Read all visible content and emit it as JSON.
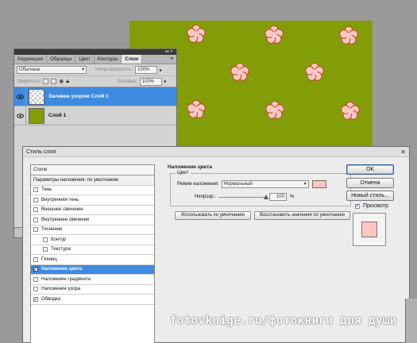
{
  "layers_panel": {
    "tabs": [
      "Коррекция",
      "Образцы",
      "Цвет",
      "Контуры",
      "Слои"
    ],
    "active_tab": "Слои",
    "blend_mode": "Обычные",
    "opacity_label": "Непрозрачность:",
    "opacity_value": "100%",
    "lock_label": "Закрепить:",
    "fill_label": "Заливка:",
    "fill_value": "100%",
    "layers": [
      {
        "name": "Заливка узором Слой 1",
        "selected": true,
        "thumb": "checker"
      },
      {
        "name": "Слой 1",
        "selected": false,
        "thumb": "green"
      }
    ]
  },
  "canvas": {
    "background": "#839d08",
    "flower_color": "#ffc8c8",
    "flower_outline": "#c05020"
  },
  "dialog": {
    "title": "Стиль слоя",
    "close": "✕",
    "styles_list": [
      {
        "label": "Стили",
        "type": "header"
      },
      {
        "label": "Параметры наложения: по умолчанию",
        "type": "param"
      },
      {
        "label": "Тень",
        "checked": false
      },
      {
        "label": "Внутренняя тень",
        "checked": false
      },
      {
        "label": "Внешнее свечение",
        "checked": false
      },
      {
        "label": "Внутреннее свечение",
        "checked": false
      },
      {
        "label": "Тиснение",
        "checked": false
      },
      {
        "label": "Контур",
        "checked": false,
        "sub": true
      },
      {
        "label": "Текстура",
        "checked": false,
        "sub": true
      },
      {
        "label": "Глянец",
        "checked": false
      },
      {
        "label": "Наложение цвета",
        "checked": true,
        "selected": true
      },
      {
        "label": "Наложение градиента",
        "checked": false
      },
      {
        "label": "Наложение узора",
        "checked": false
      },
      {
        "label": "Обводка",
        "checked": true
      }
    ],
    "section_title": "Наложение цвета",
    "group_title": "Цвет",
    "blend_mode_label": "Режим наложения:",
    "blend_mode_value": "Нормальный",
    "overlay_color": "#ffc5c0",
    "opacity_label": "Непрозр.:",
    "opacity_value": "100",
    "opacity_unit": "%",
    "opacity_fraction": 1.0,
    "btn_use_default": "Использовать по умолчанию",
    "btn_restore_default": "Восстановить значения по умолчанию",
    "btn_ok": "OK",
    "btn_cancel": "Отмена",
    "btn_new_style": "Новый стиль...",
    "preview_label": "Просмотр",
    "preview_checked": true
  },
  "watermark": "fotovknige.ru/фотокниги для души"
}
